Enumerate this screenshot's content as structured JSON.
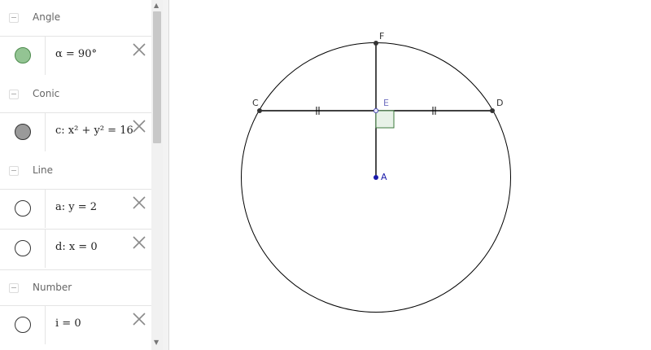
{
  "algebra_view": {
    "groups": [
      {
        "label": "Angle",
        "items": [
          {
            "text": "α = 90°",
            "marble_color": "#93c493",
            "marble_border": "#4c8a4c"
          }
        ]
      },
      {
        "label": "Conic",
        "items": [
          {
            "text": "c: x² + y² = 16",
            "marble_color": "#9a9a9a",
            "marble_border": "#333333"
          }
        ]
      },
      {
        "label": "Line",
        "items": [
          {
            "text": "a: y = 2",
            "marble_color": "#ffffff",
            "marble_border": "#333333"
          },
          {
            "text": "d: x = 0",
            "marble_color": "#ffffff",
            "marble_border": "#333333"
          }
        ]
      },
      {
        "label": "Number",
        "items": [
          {
            "text": "i = 0",
            "marble_color": "#ffffff",
            "marble_border": "#333333"
          }
        ]
      }
    ],
    "delete_icon": "close-icon",
    "collapse_icon": "minus-icon"
  },
  "graphics_view": {
    "point_labels": {
      "A": "A",
      "C": "C",
      "D": "D",
      "E": "E",
      "F": "F"
    },
    "colors": {
      "line": "#000000",
      "point_dark": "#333333",
      "point_blue": "#1a1aaa",
      "angle_fill": "#e8f2e8",
      "angle_stroke": "#3b7a3b",
      "label_E": "#7070c0"
    }
  }
}
